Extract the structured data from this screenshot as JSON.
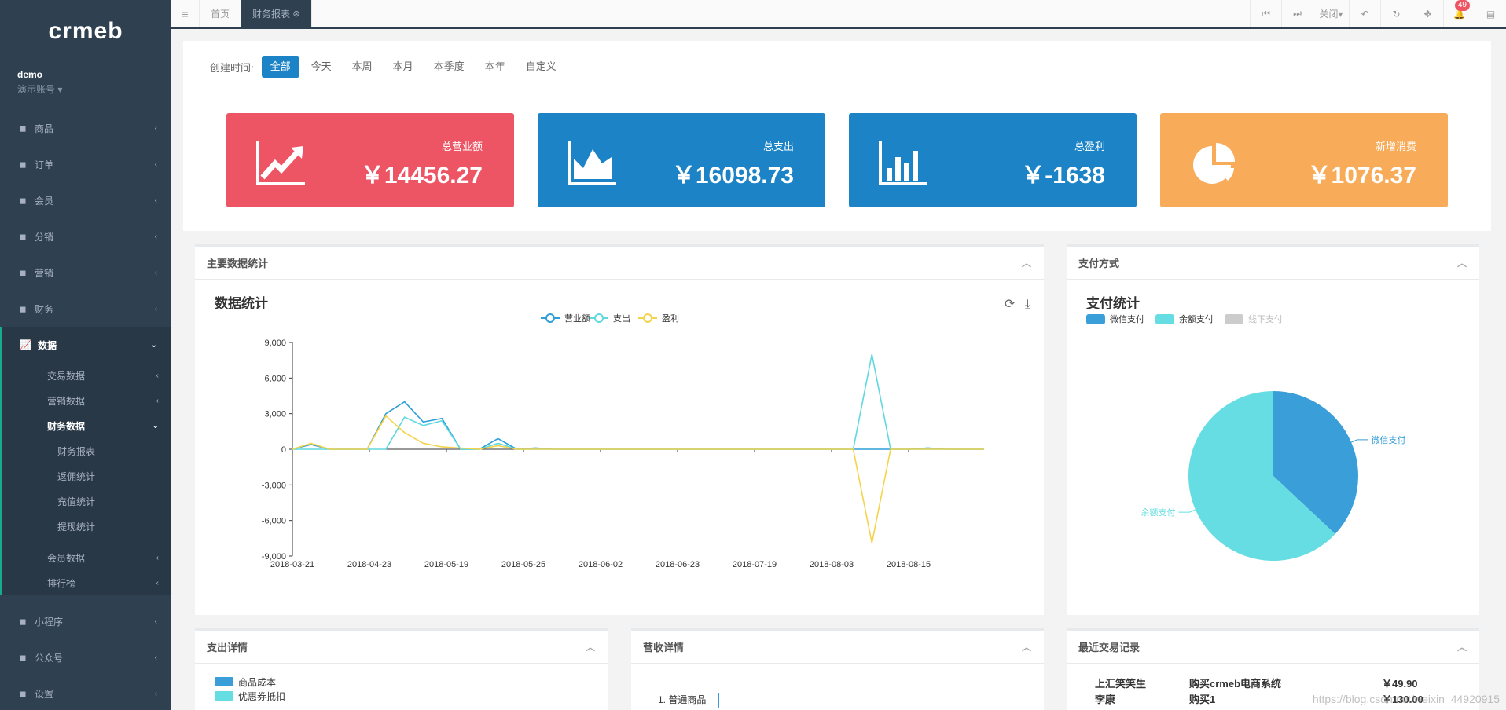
{
  "brand": {
    "logo_text": "crmeb"
  },
  "user": {
    "name": "demo",
    "role": "演示账号"
  },
  "nav": {
    "items_top": [
      {
        "label": "商品",
        "icon": "laptop-icon"
      },
      {
        "label": "订单",
        "icon": "document-icon"
      },
      {
        "label": "会员",
        "icon": "user-icon"
      },
      {
        "label": "分销",
        "icon": "users-icon"
      },
      {
        "label": "营销",
        "icon": "paper-plane-icon"
      },
      {
        "label": "财务",
        "icon": "money-icon"
      }
    ],
    "active": {
      "label": "数据",
      "icon": "line-chart-icon"
    },
    "sub": [
      "交易数据",
      "营销数据"
    ],
    "sub_open": "财务数据",
    "sub_items": [
      "财务报表",
      "返佣统计",
      "充值统计",
      "提现统计"
    ],
    "sub_after": [
      "会员数据",
      "排行榜"
    ],
    "items_bottom": [
      {
        "label": "小程序",
        "icon": "mini-program-icon"
      },
      {
        "label": "公众号",
        "icon": "wechat-icon"
      },
      {
        "label": "设置",
        "icon": "gear-icon"
      }
    ]
  },
  "topbar": {
    "tabs": [
      "首页",
      "财务报表"
    ],
    "close_label": "关闭",
    "notifications": "49"
  },
  "filter": {
    "label": "创建时间:",
    "options": [
      "全部",
      "今天",
      "本周",
      "本月",
      "本季度",
      "本年",
      "自定义"
    ],
    "selected": "全部"
  },
  "cards": [
    {
      "label": "总营业额",
      "value": "￥14456.27",
      "color": "#ed5565",
      "icon": "trend-up-icon"
    },
    {
      "label": "总支出",
      "value": "￥16098.73",
      "color": "#1c84c6",
      "icon": "area-chart-icon"
    },
    {
      "label": "总盈利",
      "value": "￥-1638",
      "color": "#1c84c6",
      "icon": "bar-chart-icon"
    },
    {
      "label": "新增消费",
      "value": "￥1076.37",
      "color": "#f8ac59",
      "icon": "pie-chart-icon"
    }
  ],
  "panels": {
    "main": "主要数据统计",
    "payment": "支付方式",
    "expense": "支出详情",
    "revenue": "营收详情",
    "transactions": "最近交易记录"
  },
  "chart_data": [
    {
      "type": "line",
      "title": "数据统计",
      "x": [
        "2018-03-21",
        "",
        "2018-04-23",
        "",
        "2018-05-19",
        "",
        "2018-05-25",
        "",
        "2018-06-02",
        "",
        "2018-06-23",
        "",
        "2018-07-19",
        "",
        "2018-08-03",
        "",
        "2018-08-15",
        ""
      ],
      "xticks": [
        "2018-03-21",
        "2018-04-23",
        "2018-05-19",
        "2018-05-25",
        "2018-06-02",
        "2018-06-23",
        "2018-07-19",
        "2018-08-03",
        "2018-08-15"
      ],
      "ylim": [
        -9000,
        9000
      ],
      "yticks": [
        "9,000",
        "6,000",
        "3,000",
        "0",
        "-3,000",
        "-6,000",
        "-9,000"
      ],
      "series": [
        {
          "name": "营业额",
          "color": "#2f9fd8",
          "values": [
            0,
            400,
            0,
            0,
            0,
            3000,
            4000,
            2300,
            2600,
            0,
            0,
            900,
            0,
            100,
            0,
            0,
            0,
            0,
            0,
            0,
            0,
            0,
            0,
            0,
            0,
            0,
            0,
            0,
            0,
            0,
            0,
            0,
            0,
            0,
            100,
            0,
            0,
            0
          ]
        },
        {
          "name": "支出",
          "color": "#5fd8e0",
          "values": [
            0,
            0,
            0,
            0,
            0,
            0,
            2700,
            2000,
            2400,
            0,
            0,
            500,
            0,
            0,
            0,
            0,
            0,
            0,
            0,
            0,
            0,
            0,
            0,
            0,
            0,
            0,
            0,
            0,
            0,
            0,
            0,
            8000,
            0,
            0,
            0,
            0,
            0,
            0
          ]
        },
        {
          "name": "盈利",
          "color": "#f5d34a",
          "values": [
            0,
            500,
            0,
            0,
            0,
            2800,
            1400,
            500,
            200,
            100,
            0,
            300,
            0,
            0,
            0,
            0,
            0,
            0,
            0,
            0,
            0,
            0,
            0,
            0,
            0,
            0,
            0,
            0,
            0,
            0,
            0,
            -7900,
            0,
            0,
            0,
            0,
            0,
            0
          ]
        }
      ],
      "legend": "top-center"
    },
    {
      "type": "pie",
      "title": "支付统计",
      "legend": [
        "微信支付",
        "余额支付",
        "线下支付"
      ],
      "legend_colors": [
        "#3a9ed9",
        "#66dde2",
        "#cccccc"
      ],
      "values": [
        37,
        63,
        0
      ],
      "labels": [
        "微信支付",
        "余额支付"
      ]
    }
  ],
  "expense_legend": [
    "商品成本",
    "优惠券抵扣"
  ],
  "revenue_first": "1. 普通商品",
  "transactions": [
    {
      "user": "上汇笑笑生",
      "item": "购买crmeb电商系统",
      "amount": "￥49.90"
    },
    {
      "user": "李康",
      "item": "购买1",
      "amount": "￥130.00"
    }
  ],
  "watermark": "https://blog.csdn.net/weixin_44920915"
}
